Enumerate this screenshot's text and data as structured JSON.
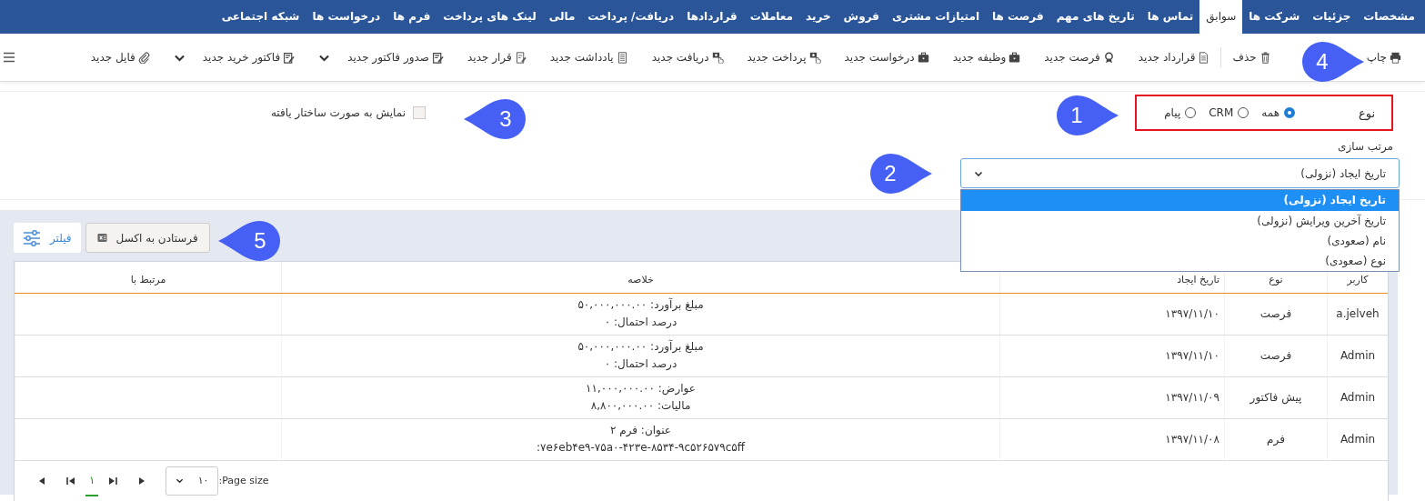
{
  "tabs": [
    {
      "label": "مشخصات",
      "selected": false
    },
    {
      "label": "جزئیات",
      "selected": false
    },
    {
      "label": "شرکت ها",
      "selected": false
    },
    {
      "label": "سوابق",
      "selected": true
    },
    {
      "label": "تماس ها",
      "selected": false
    },
    {
      "label": "تاریخ های مهم",
      "selected": false
    },
    {
      "label": "فرصت ها",
      "selected": false
    },
    {
      "label": "امتیازات مشتری",
      "selected": false
    },
    {
      "label": "فروش",
      "selected": false
    },
    {
      "label": "خرید",
      "selected": false
    },
    {
      "label": "معاملات",
      "selected": false
    },
    {
      "label": "قراردادها",
      "selected": false
    },
    {
      "label": "دریافت/ پرداخت",
      "selected": false
    },
    {
      "label": "مالی",
      "selected": false
    },
    {
      "label": "لینک های پرداخت",
      "selected": false
    },
    {
      "label": "فرم ها",
      "selected": false
    },
    {
      "label": "درخواست ها",
      "selected": false
    },
    {
      "label": "شبکه اجتماعی",
      "selected": false
    }
  ],
  "toolbar": {
    "groups": [
      [
        {
          "label": "چاپ",
          "kind": "button"
        },
        {
          "label": "حذف",
          "kind": "button"
        }
      ],
      [
        {
          "label": "قرارداد جدید",
          "kind": "button"
        },
        {
          "label": "فرصت جدید",
          "kind": "button"
        },
        {
          "label": "وظیفه جدید",
          "kind": "button"
        },
        {
          "label": "درخواست جدید",
          "kind": "button"
        },
        {
          "label": "پرداخت جدید",
          "kind": "button"
        },
        {
          "label": "دریافت جدید",
          "kind": "button"
        },
        {
          "label": "یادداشت جدید",
          "kind": "button"
        },
        {
          "label": "قرار جدید",
          "kind": "button"
        },
        {
          "label": "صدور فاکتور جدید",
          "kind": "dropdown"
        },
        {
          "label": "فاکتور خرید جدید",
          "kind": "dropdown"
        },
        {
          "label": "فایل جدید",
          "kind": "button"
        }
      ]
    ]
  },
  "filter": {
    "type_label": "نوع",
    "type_options": [
      {
        "label": "همه",
        "selected": true
      },
      {
        "label": "CRM",
        "selected": false
      },
      {
        "label": "پیام",
        "selected": false
      }
    ],
    "sort_label": "مرتب سازی",
    "sort_value": "تاریخ ایجاد (نزولی)",
    "sort_options": [
      {
        "label": "تاریخ ایجاد (نزولی)",
        "selected": true
      },
      {
        "label": "تاریخ آخرین ویرایش (نزولی)",
        "selected": false
      },
      {
        "label": "نام (صعودی)",
        "selected": false
      },
      {
        "label": "نوع (صعودی)",
        "selected": false
      }
    ],
    "structured": {
      "label": "نمایش به صورت ساختار یافته",
      "checked": false
    }
  },
  "grid": {
    "filter_button": "فیلتر",
    "excel_button": "فرستادن به اکسل",
    "columns": [
      "کاربر",
      "نوع",
      "تاریخ ایجاد",
      "خلاصه",
      "مرتبط با"
    ],
    "rows": [
      {
        "user": "a.jelveh",
        "type": "فرصت",
        "date": "۱۳۹۷/۱۱/۱۰",
        "summary": [
          "مبلغ برآورد: ۵۰,۰۰۰,۰۰۰.۰۰",
          "درصد احتمال: ۰"
        ]
      },
      {
        "user": "Admin",
        "type": "فرصت",
        "date": "۱۳۹۷/۱۱/۱۰",
        "summary": [
          "مبلغ برآورد: ۵۰,۰۰۰,۰۰۰.۰۰",
          "درصد احتمال: ۰"
        ]
      },
      {
        "user": "Admin",
        "type": "پیش فاکتور",
        "date": "۱۳۹۷/۱۱/۰۹",
        "summary": [
          "عوارض: ۱۱,۰۰۰,۰۰۰.۰۰",
          "مالیات: ۸,۸۰۰,۰۰۰.۰۰"
        ]
      },
      {
        "user": "Admin",
        "type": "فرم",
        "date": "۱۳۹۷/۱۱/۰۸",
        "summary": [
          "عنوان: فرم ۲",
          "۷e۶eb۴e۹-۷۵a۰-۴۲۳e-۸۵۳۴-۹c۵۲۶۵۷۹c۵ff:"
        ]
      }
    ],
    "pager": {
      "page_size_label": "Page size:",
      "page_size": "۱۰",
      "pages": [
        {
          "label": "۱",
          "selected": true
        }
      ]
    }
  },
  "callouts": [
    {
      "number": "1"
    },
    {
      "number": "2"
    },
    {
      "number": "3"
    },
    {
      "number": "4"
    },
    {
      "number": "5"
    }
  ]
}
